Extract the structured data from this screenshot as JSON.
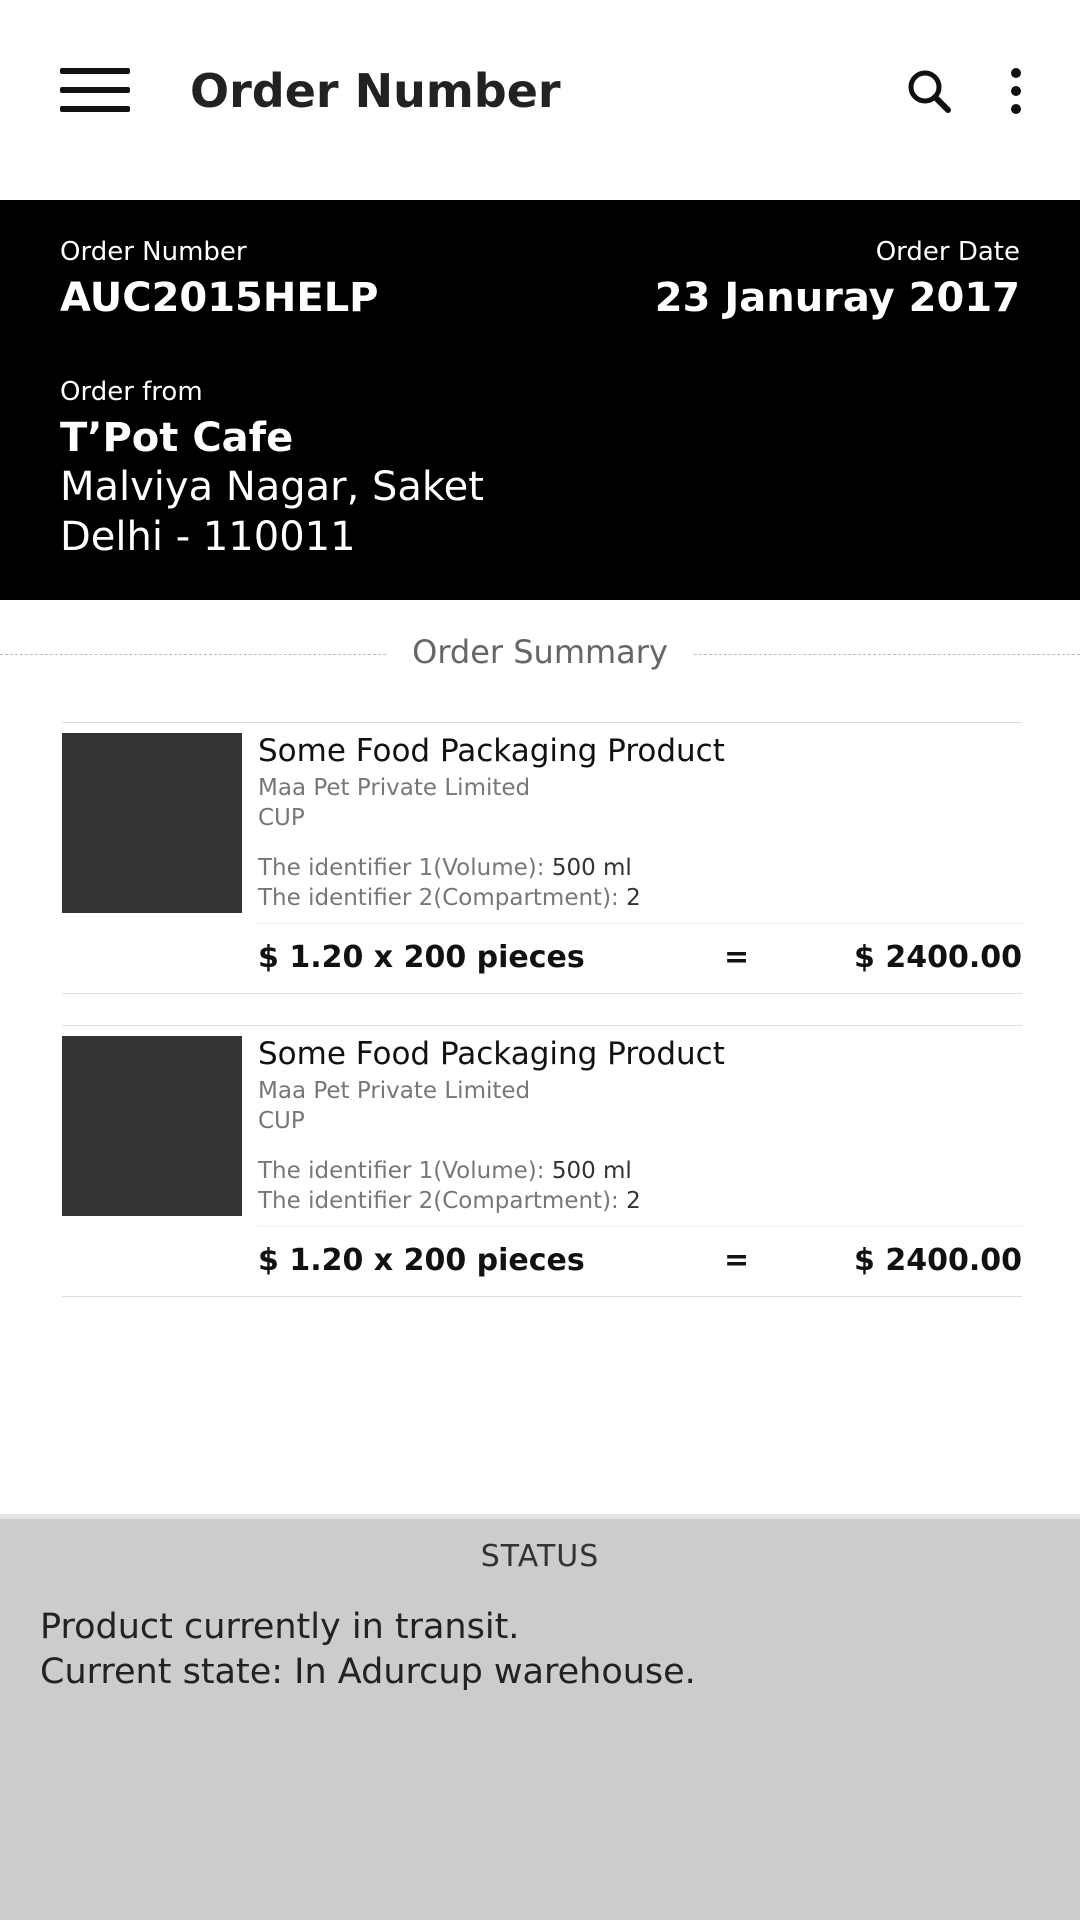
{
  "appbar": {
    "title": "Order Number",
    "menu_icon": "hamburger-menu-icon",
    "search_icon": "search-icon",
    "more_icon": "more-vertical-icon"
  },
  "order": {
    "number_label": "Order Number",
    "number": "AUC2015HELP",
    "date_label": "Order Date",
    "date": "23 Januray 2017",
    "from_label": "Order from",
    "from_name": "T’Pot Cafe",
    "address_line1": "Malviya Nagar, Saket",
    "address_line2": "Delhi - 110011"
  },
  "summary": {
    "heading": "Order Summary",
    "items": [
      {
        "name": "Some Food Packaging Product",
        "vendor": "Maa Pet Private Limited",
        "type": "CUP",
        "attr1_key": "The identifier 1(Volume):",
        "attr1_value": "500 ml",
        "attr2_key": "The identifier 2(Compartment):",
        "attr2_value": "2",
        "unit_price": "$ 1.20 x 200 pieces",
        "equals": "=",
        "total": "$ 2400.00"
      },
      {
        "name": "Some Food Packaging Product",
        "vendor": "Maa Pet Private Limited",
        "type": "CUP",
        "attr1_key": "The identifier 1(Volume):",
        "attr1_value": "500 ml",
        "attr2_key": "The identifier 2(Compartment):",
        "attr2_value": "2",
        "unit_price": "$ 1.20 x 200 pieces",
        "equals": "=",
        "total": "$ 2400.00"
      }
    ]
  },
  "status": {
    "title": "STATUS",
    "line1": "Product currently in transit.",
    "line2": "Current state: In Adurcup warehouse."
  },
  "colors": {
    "header_bg": "#000000",
    "status_bg": "#cccccc",
    "thumbnail": "#333333"
  }
}
